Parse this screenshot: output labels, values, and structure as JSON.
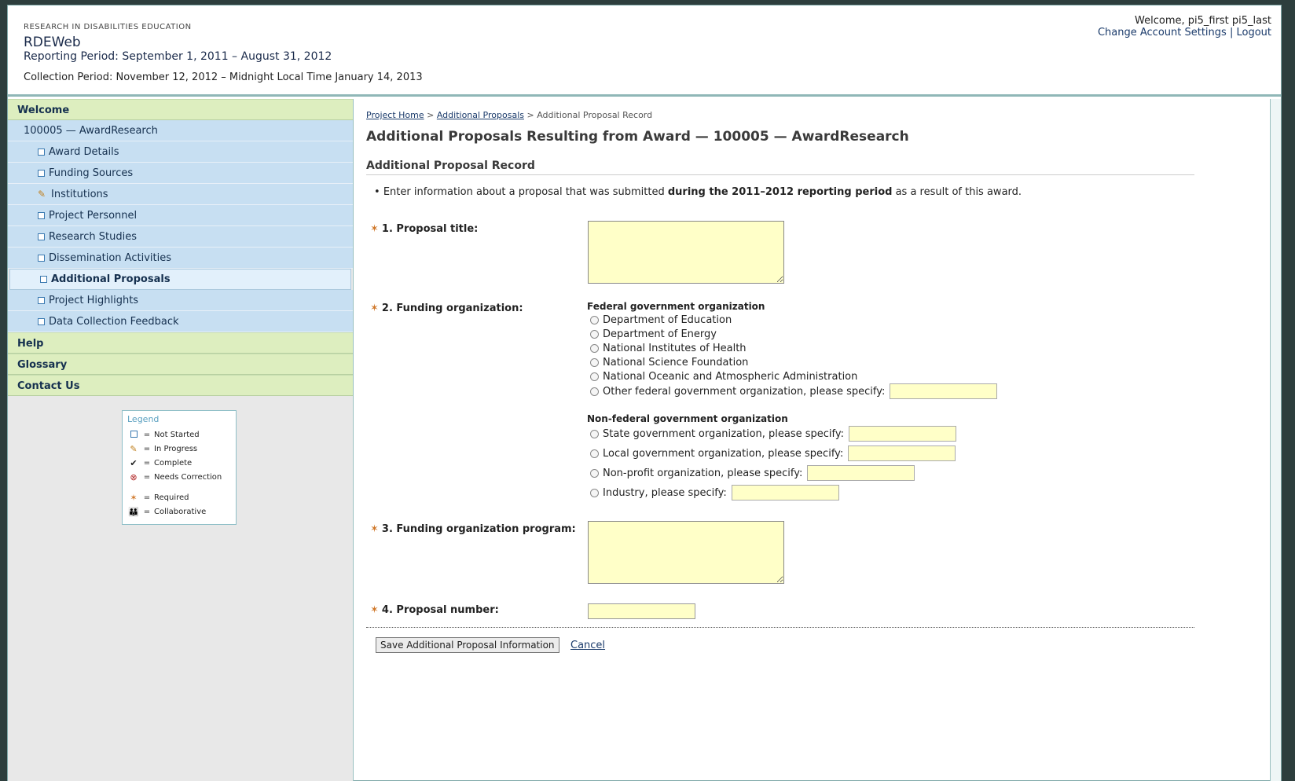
{
  "header": {
    "org": "RESEARCH IN DISABILITIES EDUCATION",
    "app_name": "RDEWeb",
    "reporting_period": "Reporting Period: September 1, 2011 – August 31, 2012",
    "collection_period": "Collection Period: November 12, 2012 – Midnight Local Time January 14, 2013",
    "welcome": "Welcome, pi5_first pi5_last",
    "change_settings": "Change Account Settings",
    "separator": "|",
    "logout": "Logout"
  },
  "sidebar": {
    "welcome": "Welcome",
    "award": "100005 — AwardResearch",
    "items": [
      {
        "label": "Award Details",
        "status": "not-started"
      },
      {
        "label": "Funding Sources",
        "status": "not-started"
      },
      {
        "label": "Institutions",
        "status": "in-progress"
      },
      {
        "label": "Project Personnel",
        "status": "not-started"
      },
      {
        "label": "Research Studies",
        "status": "not-started"
      },
      {
        "label": "Dissemination Activities",
        "status": "not-started"
      },
      {
        "label": "Additional Proposals",
        "status": "not-started"
      },
      {
        "label": "Project Highlights",
        "status": "not-started"
      },
      {
        "label": "Data Collection Feedback",
        "status": "not-started"
      }
    ],
    "help": "Help",
    "glossary": "Glossary",
    "contact": "Contact Us"
  },
  "legend": {
    "title": "Legend",
    "not_started": "Not Started",
    "in_progress": "In Progress",
    "complete": "Complete",
    "needs_correction": "Needs Correction",
    "required": "Required",
    "collaborative": "Collaborative",
    "eq": "="
  },
  "breadcrumb": {
    "home": "Project Home",
    "sep": ">",
    "proposals": "Additional Proposals",
    "current": "Additional Proposal Record"
  },
  "main": {
    "title": "Additional Proposals Resulting from Award — 100005 — AwardResearch",
    "section": "Additional Proposal Record",
    "intro_pre": "Enter information about a proposal that was submitted ",
    "intro_bold": "during the 2011–2012 reporting period",
    "intro_post": " as a result of this award."
  },
  "questions": {
    "q1": "1. Proposal title:",
    "q2": "2. Funding organization:",
    "q3": "3. Funding organization program:",
    "q4": "4. Proposal number:",
    "star": "✶"
  },
  "funding": {
    "federal_heading": "Federal government organization",
    "federal": [
      "Department of Education",
      "Department of Energy",
      "National Institutes of Health",
      "National Science Foundation",
      "National Oceanic and Atmospheric Administration"
    ],
    "other_federal": "Other federal government organization, please specify:",
    "nonfederal_heading": "Non-federal government organization",
    "state": "State government organization, please specify:",
    "local": "Local government organization, please specify:",
    "nonprofit": "Non-profit organization, please specify:",
    "industry": "Industry, please specify:"
  },
  "actions": {
    "save": "Save Additional Proposal Information",
    "cancel": "Cancel"
  },
  "colors": {
    "input_bg": "#ffffc8",
    "nav_green": "#ddeebf",
    "nav_blue": "#c7dff2",
    "required_star": "#d0782a"
  }
}
